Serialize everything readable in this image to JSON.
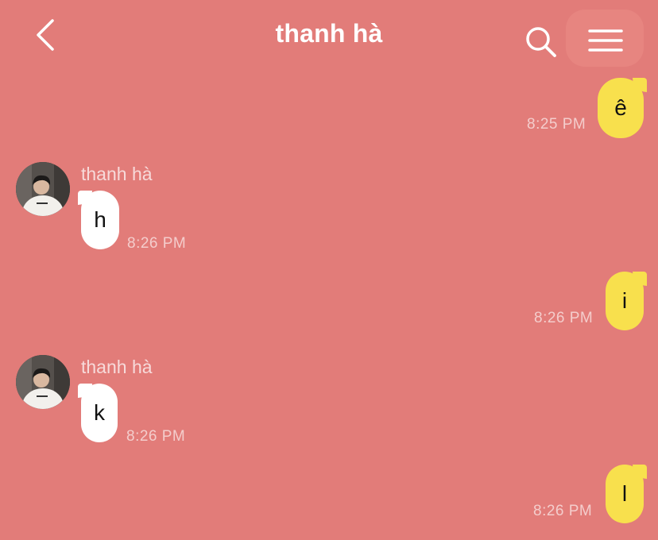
{
  "header": {
    "title": "thanh hà",
    "back_icon": "chevron-left-icon",
    "search_icon": "search-icon",
    "menu_icon": "hamburger-menu-icon"
  },
  "colors": {
    "background": "#e27c79",
    "my_bubble": "#f8e04d",
    "their_bubble": "#ffffff"
  },
  "messages": [
    {
      "from": "me",
      "text": "ê",
      "time": "8:25 PM"
    },
    {
      "from": "them",
      "sender": "thanh hà",
      "text": "h",
      "time": "8:26 PM"
    },
    {
      "from": "me",
      "text": "i",
      "time": "8:26 PM"
    },
    {
      "from": "them",
      "sender": "thanh hà",
      "text": "k",
      "time": "8:26 PM"
    },
    {
      "from": "me",
      "text": "l",
      "time": "8:26 PM"
    }
  ]
}
